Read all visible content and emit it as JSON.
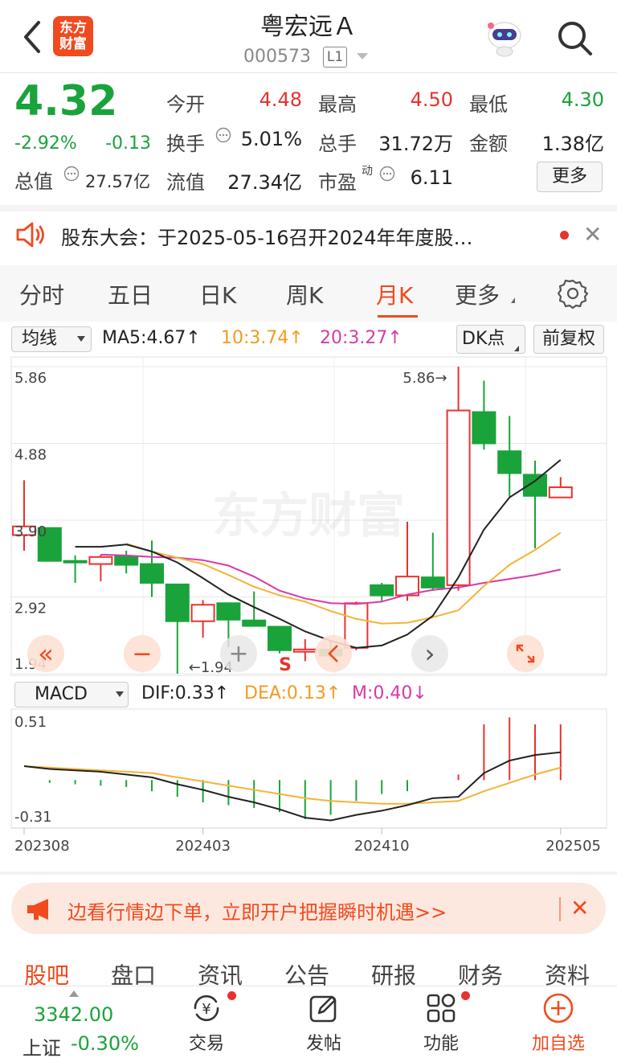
{
  "header": {
    "logo_line1": "东方",
    "logo_line2": "财富",
    "stock_name": "粤宏远Ａ",
    "stock_code": "000573",
    "level_badge": "L1"
  },
  "quote": {
    "price": "4.32",
    "change_pct": "-2.92%",
    "change": "-0.13",
    "market_value_label": "总值",
    "market_value": "27.57亿",
    "fields": [
      {
        "label": "今开",
        "value": "4.48",
        "color": "red"
      },
      {
        "label": "最高",
        "value": "4.50",
        "color": "red"
      },
      {
        "label": "最低",
        "value": "4.30",
        "color": "green"
      },
      {
        "label": "换手",
        "value": "5.01%",
        "color": "black"
      },
      {
        "label": "总手",
        "value": "31.72万",
        "color": "black"
      },
      {
        "label": "金额",
        "value": "1.38亿",
        "color": "black"
      },
      {
        "label": "流值",
        "value": "27.34亿",
        "color": "black"
      },
      {
        "label": "市盈",
        "value": "6.11",
        "color": "black"
      }
    ],
    "pe_superscript": "动",
    "more_label": "更多"
  },
  "notice": {
    "text": "股东大会：于2025-05-16召开2024年年度股…"
  },
  "period_tabs": [
    "分时",
    "五日",
    "日K",
    "周K",
    "月K",
    "更多"
  ],
  "active_period": "月K",
  "ma_bar": {
    "select_label": "均线",
    "ma5": "MA5:4.67↑",
    "ma10": "10:3.74↑",
    "ma20": "20:3.27↑",
    "dk_label": "DK点",
    "adj_label": "前复权"
  },
  "colors": {
    "up": "#e8322e",
    "down": "#1aa33a",
    "ma5": "#222222",
    "ma10": "#f5b335",
    "ma20": "#d63aa8",
    "accent": "#f04a1e"
  },
  "chart_data": [
    {
      "type": "candlestick",
      "title": "月K",
      "ylim": [
        1.94,
        5.86
      ],
      "y_ticks": [
        "5.86",
        "4.88",
        "3.90",
        "2.92",
        "1.94"
      ],
      "max_label": "5.86→",
      "min_label": "←1.94",
      "watermark": "东方财富",
      "candles": [
        {
          "o": 3.71,
          "h": 4.41,
          "l": 3.51,
          "c": 3.82
        },
        {
          "o": 3.8,
          "h": 3.8,
          "l": 3.51,
          "c": 3.38
        },
        {
          "o": 3.38,
          "h": 3.45,
          "l": 3.1,
          "c": 3.36
        },
        {
          "o": 3.34,
          "h": 3.46,
          "l": 3.12,
          "c": 3.43
        },
        {
          "o": 3.44,
          "h": 3.51,
          "l": 3.22,
          "c": 3.33
        },
        {
          "o": 3.34,
          "h": 3.64,
          "l": 2.92,
          "c": 3.1
        },
        {
          "o": 3.08,
          "h": 3.08,
          "l": 1.94,
          "c": 2.61
        },
        {
          "o": 2.61,
          "h": 2.88,
          "l": 2.4,
          "c": 2.82
        },
        {
          "o": 2.84,
          "h": 2.84,
          "l": 2.28,
          "c": 2.63
        },
        {
          "o": 2.62,
          "h": 2.99,
          "l": 2.55,
          "c": 2.55
        },
        {
          "o": 2.54,
          "h": 2.54,
          "l": 2.2,
          "c": 2.24
        },
        {
          "o": 2.22,
          "h": 2.38,
          "l": 2.1,
          "c": 2.25
        },
        {
          "o": 2.25,
          "h": 2.36,
          "l": 2.15,
          "c": 2.17
        },
        {
          "o": 2.27,
          "h": 2.86,
          "l": 2.24,
          "c": 2.84
        },
        {
          "o": 3.07,
          "h": 3.1,
          "l": 2.87,
          "c": 2.94
        },
        {
          "o": 2.94,
          "h": 3.88,
          "l": 2.87,
          "c": 3.18
        },
        {
          "o": 3.17,
          "h": 3.74,
          "l": 3.0,
          "c": 3.04
        },
        {
          "o": 3.07,
          "h": 5.86,
          "l": 3.0,
          "c": 5.3
        },
        {
          "o": 5.28,
          "h": 5.68,
          "l": 4.8,
          "c": 4.88
        },
        {
          "o": 4.78,
          "h": 5.23,
          "l": 4.2,
          "c": 4.5
        },
        {
          "o": 4.48,
          "h": 4.66,
          "l": 3.54,
          "c": 4.21
        },
        {
          "o": 4.19,
          "h": 4.45,
          "l": 4.2,
          "c": 4.32
        }
      ],
      "ma5": [
        3.56,
        3.56,
        3.59,
        3.5,
        3.36,
        3.16,
        2.95,
        2.79,
        2.64,
        2.48,
        2.36,
        2.27,
        2.3,
        2.44,
        2.68,
        3.17,
        3.78,
        4.19,
        4.4,
        4.67
      ],
      "ma10": [
        3.6,
        3.5,
        3.42,
        3.34,
        3.2,
        3.05,
        2.94,
        2.86,
        2.74,
        2.64,
        2.58,
        2.59,
        2.66,
        2.75,
        3.06,
        3.33,
        3.52,
        3.74
      ],
      "ma20": [
        3.46,
        3.45,
        3.43,
        3.42,
        3.39,
        3.32,
        3.18,
        3.0,
        2.9,
        2.84,
        2.83,
        2.86,
        2.95,
        3.01,
        3.04,
        3.1,
        3.15,
        3.2,
        3.27
      ]
    },
    {
      "type": "bar",
      "title": "MACD",
      "ylim": [
        -0.31,
        0.51
      ],
      "y_ticks": [
        "0.51",
        "-0.31"
      ],
      "x_ticks": [
        "202308",
        "202403",
        "202410",
        "202505"
      ],
      "dif_label": "DIF:0.33↑",
      "dea_label": "DEA:0.13↑",
      "m_label": "M:0.40↓",
      "macd_bars": [
        0.0,
        -0.02,
        -0.03,
        -0.04,
        -0.05,
        -0.08,
        -0.12,
        -0.16,
        -0.18,
        -0.2,
        -0.23,
        -0.28,
        -0.25,
        -0.15,
        -0.1,
        -0.08,
        0.0,
        0.04,
        0.4,
        0.45,
        0.4,
        0.4
      ],
      "dif": [
        0.1,
        0.08,
        0.07,
        0.06,
        0.04,
        0.02,
        -0.03,
        -0.07,
        -0.12,
        -0.16,
        -0.21,
        -0.27,
        -0.29,
        -0.25,
        -0.22,
        -0.18,
        -0.13,
        -0.12,
        0.05,
        0.14,
        0.18,
        0.2
      ],
      "dea": [
        0.1,
        0.09,
        0.08,
        0.07,
        0.06,
        0.05,
        0.02,
        -0.01,
        -0.04,
        -0.07,
        -0.1,
        -0.13,
        -0.15,
        -0.16,
        -0.17,
        -0.17,
        -0.16,
        -0.15,
        -0.08,
        -0.02,
        0.04,
        0.09
      ]
    }
  ],
  "chart_controls": {
    "zoom_out": "«",
    "minus": "−",
    "plus": "+",
    "next": "›",
    "s_marker": "S"
  },
  "macd_select_label": "MACD",
  "banner": {
    "text": "边看行情边下单，立即开户把握瞬时机遇>>"
  },
  "info_tabs": [
    "股吧",
    "盘口",
    "资讯",
    "公告",
    "研报",
    "财务",
    "资料"
  ],
  "bottom_bar": {
    "index_value": "3342.00",
    "index_name": "上证",
    "index_change": "-0.30%",
    "items": [
      "交易",
      "发帖",
      "功能",
      "加自选"
    ]
  }
}
